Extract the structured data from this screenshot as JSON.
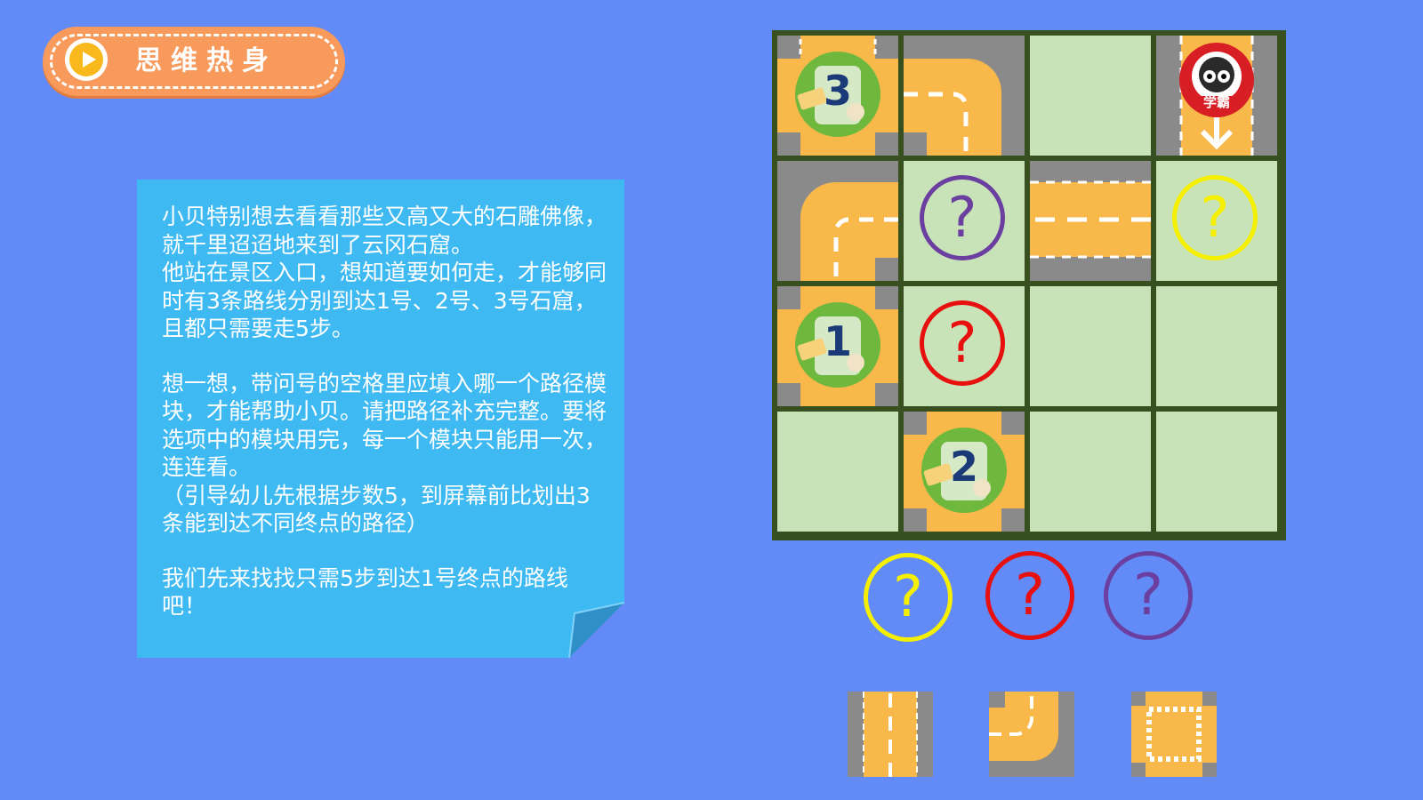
{
  "header": {
    "title": "思维热身",
    "play_icon": "play-icon"
  },
  "note": {
    "paragraphs": [
      "小贝特别想去看看那些又高又大的石雕佛像，就千里迢迢地来到了云冈石窟。\n他站在景区入口，想知道要如何走，才能够同时有3条路线分别到达1号、2号、3号石窟，且都只需要走5步。",
      "想一想，带问号的空格里应填入哪一个路径模块，才能帮助小贝。请把路径补充完整。要将选项中的模块用完，每一个模块只能用一次，连连看。\n（引导幼儿先根据步数5，到屏幕前比划出3条能到达不同终点的路径）",
      "我们先来找找只需5步到达1号终点的路线吧！"
    ]
  },
  "colors": {
    "background": "#638bf7",
    "yellow": "#f5f000",
    "red": "#e80f0f",
    "purple": "#6b3fa0",
    "road": "#f9b84a",
    "asphalt": "#8a8a8a",
    "grass": "#c9e3b8"
  },
  "grid": {
    "start_badge": "学霸",
    "endpoints": [
      {
        "label": "3"
      },
      {
        "label": "1"
      },
      {
        "label": "2"
      }
    ],
    "question_cells": [
      {
        "mark": "?",
        "color": "purple"
      },
      {
        "mark": "?",
        "color": "yellow"
      },
      {
        "mark": "?",
        "color": "red"
      }
    ]
  },
  "options": {
    "circles": [
      {
        "mark": "?",
        "color": "yellow"
      },
      {
        "mark": "?",
        "color": "red"
      },
      {
        "mark": "?",
        "color": "purple"
      }
    ],
    "tiles": [
      "straight-road-tile",
      "curve-road-tile",
      "crossroad-tile"
    ]
  }
}
